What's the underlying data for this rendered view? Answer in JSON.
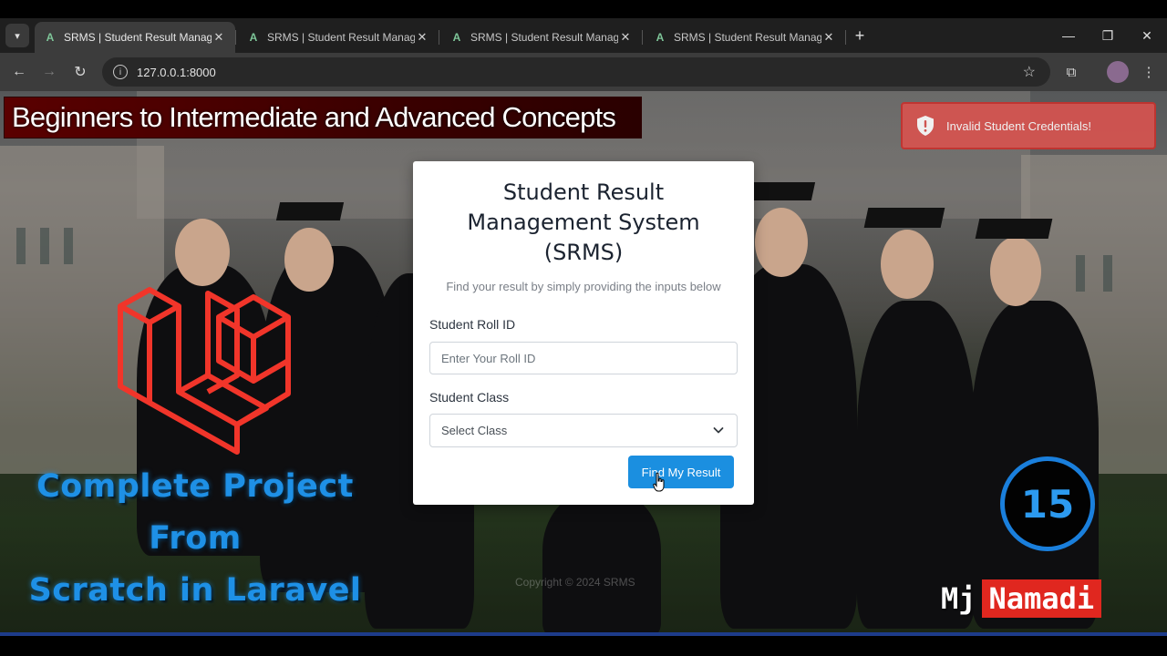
{
  "browser": {
    "tabs": [
      {
        "title": "SRMS | Student Result Management",
        "favicon": "A",
        "active": true
      },
      {
        "title": "SRMS | Student Result Management",
        "favicon": "A",
        "active": false
      },
      {
        "title": "SRMS | Student Result Management",
        "favicon": "A",
        "active": false
      },
      {
        "title": "SRMS | Student Result Management",
        "favicon": "A",
        "active": false
      }
    ],
    "url": "127.0.0.1:8000",
    "icons": [
      "tab-list-icon",
      "new-tab-icon",
      "minimize-icon",
      "restore-icon",
      "close-icon",
      "back-icon",
      "forward-icon",
      "reload-icon",
      "site-info-icon",
      "bookmark-star-icon",
      "extensions-icon",
      "profile-avatar",
      "more-menu-icon"
    ]
  },
  "overlay": {
    "banner": "Beginners to Intermediate and Advanced Concepts",
    "promo_line1": "Complete Project",
    "promo_line2": "From",
    "promo_line3": "Scratch in Laravel",
    "episode_number": "15",
    "brand_first": "Mj",
    "brand_second": "Namadi",
    "logo": "laravel-logo"
  },
  "toast": {
    "message": "Invalid Student Credentials!",
    "color": "#d9534f"
  },
  "form": {
    "title_line1": "Student Result",
    "title_line2": "Management System",
    "title_line3": "(SRMS)",
    "subtitle": "Find your result by simply providing the inputs below",
    "roll_label": "Student Roll ID",
    "roll_placeholder": "Enter Your Roll ID",
    "class_label": "Student Class",
    "class_selected": "Select Class",
    "submit_label": "Find My Result",
    "accent": "#1b8fe0"
  },
  "footer": {
    "copyright": "Copyright © 2024 SRMS"
  }
}
